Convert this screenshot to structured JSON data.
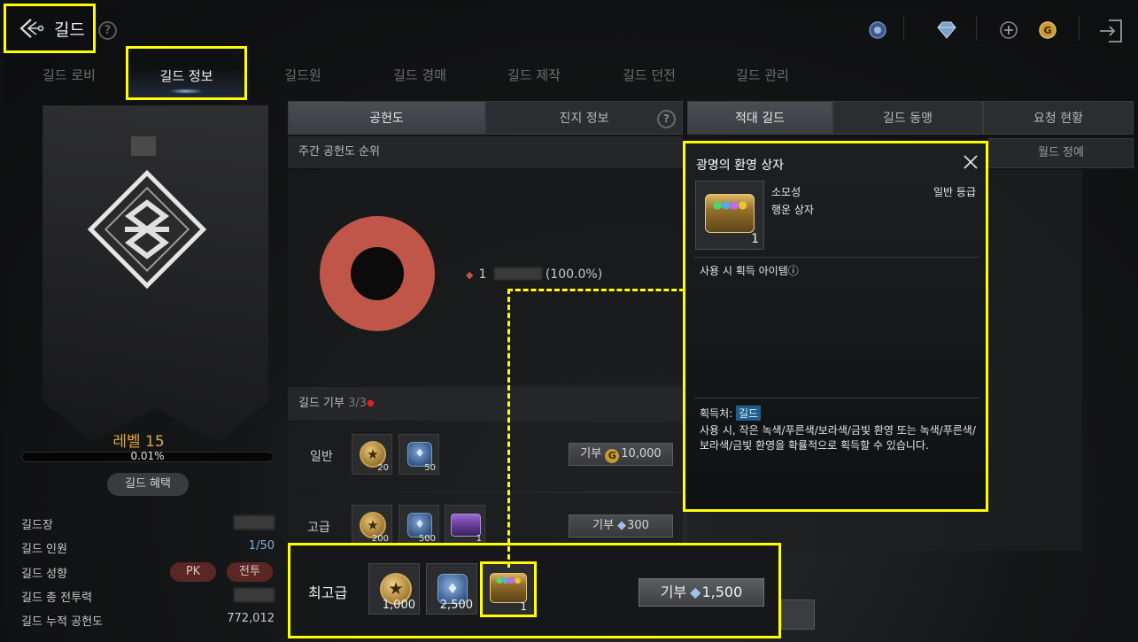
{
  "header": {
    "back_label": "길드",
    "help_icon": "?",
    "currencies": [
      "blue-emblem-icon",
      "diamond-icon",
      "plus-icon",
      "gold-coin-icon"
    ]
  },
  "main_tabs": [
    "길드 로비",
    "길드 정보",
    "길드원",
    "길드 경매",
    "길드 제작",
    "길드 던전",
    "길드 관리"
  ],
  "active_main_tab": "길드 정보",
  "left_panel": {
    "level": "레벨 15",
    "progress": "0.01%",
    "progress_value": 0.0001,
    "benefit_button": "길드 혜택",
    "info": [
      {
        "label": "길드장",
        "value": ""
      },
      {
        "label": "길드 인원",
        "value": "1/50"
      },
      {
        "label": "길드 성향",
        "pk": "PK",
        "war": "전투"
      },
      {
        "label": "길드 총 전투력",
        "value": ""
      },
      {
        "label": "길드 누적 공헌도",
        "value": "772,012"
      }
    ]
  },
  "center": {
    "subtabs": [
      "공헌도",
      "진지 정보"
    ],
    "ranking_header": "주간 공헌도 순위",
    "legend": {
      "rank": "1",
      "pct": "(100.0%)"
    },
    "donate_header": "길드 기부",
    "donate_count": "3/3",
    "rows": [
      {
        "label": "일반",
        "items": [
          {
            "count": "20"
          },
          {
            "count": "50"
          }
        ],
        "button": "기부",
        "cost": "10,000"
      },
      {
        "label": "고급",
        "items": [
          {
            "count": "200"
          },
          {
            "count": "500"
          },
          {
            "count": "1"
          }
        ],
        "button": "기부",
        "cost": "300"
      }
    ],
    "top_row": {
      "label": "최고급",
      "items": [
        {
          "count": "1,000"
        },
        {
          "count": "2,500"
        },
        {
          "count": "1"
        }
      ],
      "button": "기부",
      "cost": "1,500"
    }
  },
  "right": {
    "subtabs": [
      "적대 길드",
      "길드 동맹",
      "요청 현황"
    ],
    "secondary_tab": "월드 정예"
  },
  "tooltip": {
    "title": "광명의 환영 상자",
    "type": "소모성",
    "grade": "일반 등급",
    "subtype": "행운 상자",
    "count": "1",
    "obtain_label": "사용 시 획득 아이템ⓘ",
    "source_label": "획득처:",
    "source_tag": "길드",
    "description": "사용 시, 작은 녹색/푸른색/보라색/금빛 환영 또는 녹색/푸른색/보라색/금빛 환영을 확률적으로 획득할 수 있습니다."
  },
  "colors": {
    "highlight": "#ffff00",
    "donut": "#c0554a",
    "level_text": "#d9a840"
  }
}
